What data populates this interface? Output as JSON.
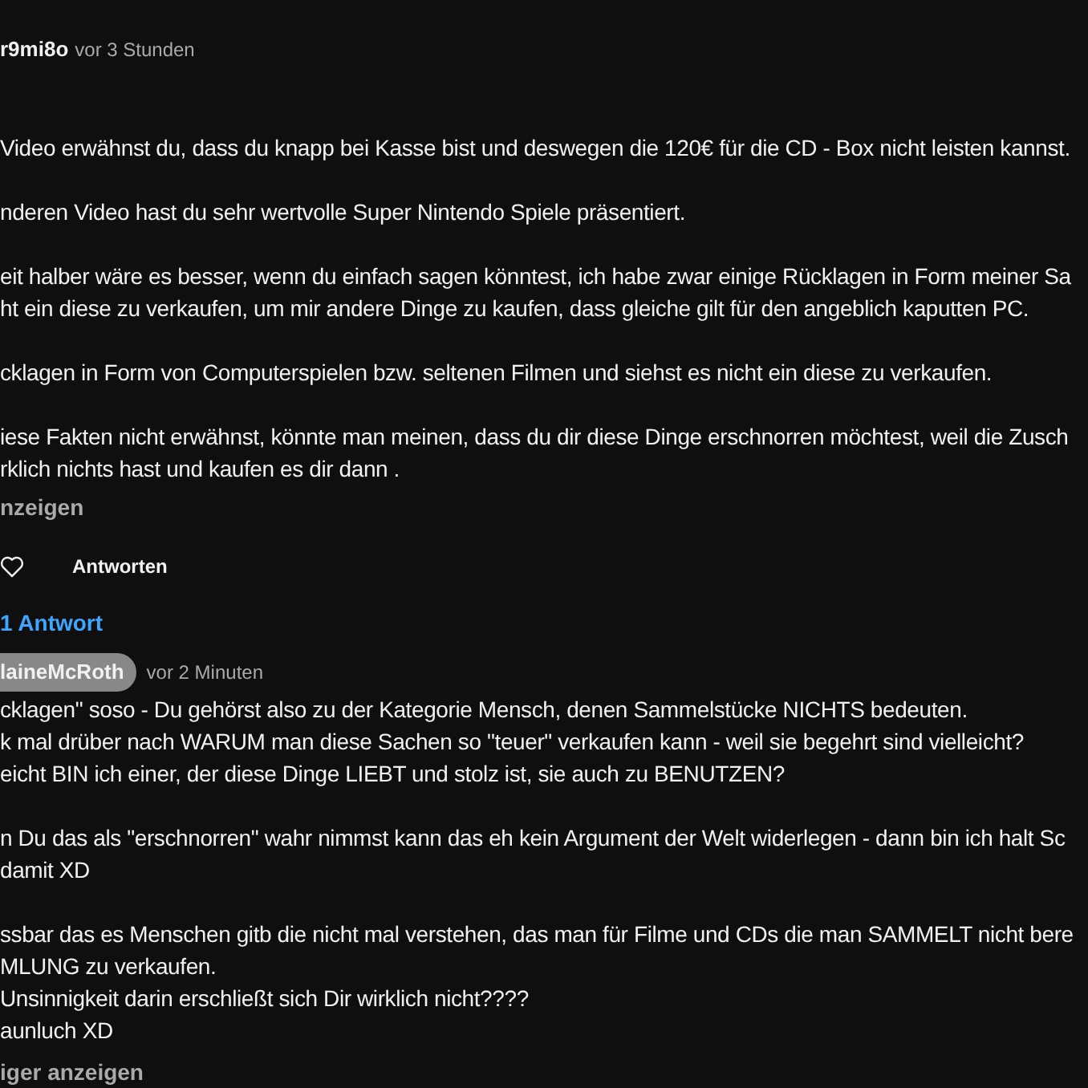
{
  "comment": {
    "author": "r9mi8o",
    "time": "vor 3 Stunden",
    "paragraphs": [
      [
        "Video erwähnst du, dass du knapp bei Kasse bist und deswegen die 120€ für die CD - Box nicht leisten kannst."
      ],
      [
        "nderen Video hast du sehr wertvolle Super Nintendo Spiele präsentiert."
      ],
      [
        "eit halber wäre es besser, wenn du einfach sagen könntest, ich habe zwar einige Rücklagen in Form meiner Sa",
        "ht ein diese zu verkaufen, um mir andere Dinge zu kaufen, dass gleiche gilt für den angeblich kaputten PC."
      ],
      [
        "cklagen in Form von Computerspielen bzw. seltenen Filmen und siehst es nicht ein diese zu verkaufen."
      ],
      [
        "iese Fakten nicht erwähnst, könnte man meinen, dass du dir diese Dinge erschnorren möchtest, weil die Zusch",
        "rklich nichts hast und kaufen es dir dann ."
      ]
    ],
    "read_more": "nzeigen",
    "reply_button": "Antworten",
    "replies_toggle": "1 Antwort"
  },
  "reply": {
    "author": "laineMcRoth",
    "author_highlighted": true,
    "time": "vor 2 Minuten",
    "paragraphs": [
      [
        "cklagen\" soso - Du gehörst also zu der Kategorie Mensch, denen Sammelstücke NICHTS bedeuten.",
        "k mal drüber nach WARUM man diese Sachen so \"teuer\" verkaufen kann - weil sie begehrt sind vielleicht?",
        "eicht BIN ich einer, der diese Dinge LIEBT und stolz ist, sie auch zu BENUTZEN?"
      ],
      [
        "n Du das als \"erschnorren\" wahr nimmst kann das eh kein Argument der Welt widerlegen - dann bin ich halt Sc",
        "damit XD"
      ],
      [
        "ssbar das es Menschen gitb die nicht mal verstehen, das man für Filme und CDs die man SAMMELT nicht bere",
        "MLUNG zu verkaufen.",
        "Unsinnigkeit darin erschließt sich Dir wirklich nicht????",
        "aunluch XD"
      ]
    ],
    "read_more": "iger anzeigen"
  }
}
